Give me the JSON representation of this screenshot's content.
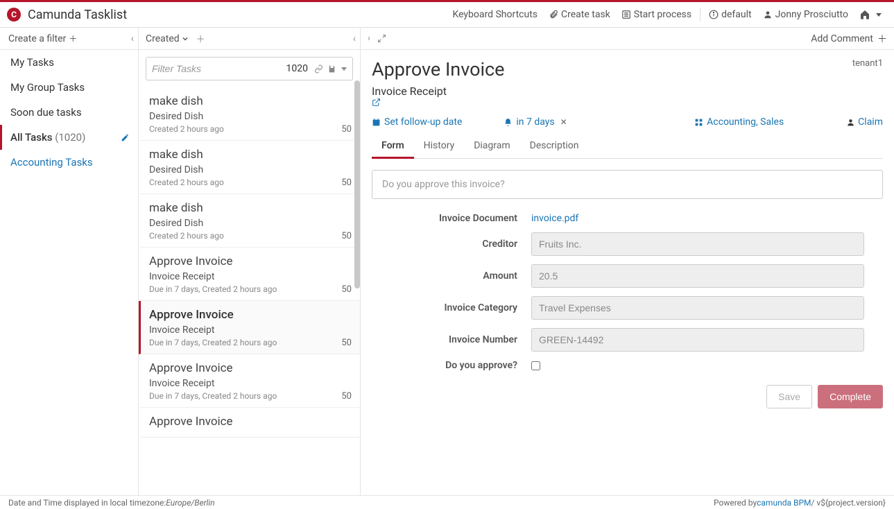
{
  "brand": {
    "logo_letter": "C",
    "title": "Camunda Tasklist",
    "keyboard_shortcuts": "Keyboard Shortcuts",
    "create_task": "Create task",
    "start_process": "Start process",
    "engine": "default",
    "user": "Jonny Prosciutto"
  },
  "filters": {
    "header": "Create a filter",
    "items": [
      {
        "label": "My Tasks",
        "count": "",
        "active": false,
        "link": false
      },
      {
        "label": "My Group Tasks",
        "count": "",
        "active": false,
        "link": false
      },
      {
        "label": "Soon due tasks",
        "count": "",
        "active": false,
        "link": false
      },
      {
        "label": "All Tasks",
        "count": "(1020)",
        "active": true,
        "link": false
      },
      {
        "label": "Accounting Tasks",
        "count": "",
        "active": false,
        "link": true
      }
    ]
  },
  "tasks": {
    "sort_label": "Created",
    "filter_placeholder": "Filter Tasks",
    "filter_count": "1020",
    "items": [
      {
        "title": "make dish",
        "sub": "Desired Dish",
        "meta": "Created 2 hours ago",
        "prio": "50",
        "selected": false
      },
      {
        "title": "make dish",
        "sub": "Desired Dish",
        "meta": "Created 2 hours ago",
        "prio": "50",
        "selected": false
      },
      {
        "title": "make dish",
        "sub": "Desired Dish",
        "meta": "Created 2 hours ago",
        "prio": "50",
        "selected": false
      },
      {
        "title": "Approve Invoice",
        "sub": "Invoice Receipt",
        "meta": "Due in 7 days, Created 2 hours ago",
        "prio": "50",
        "selected": false
      },
      {
        "title": "Approve Invoice",
        "sub": "Invoice Receipt",
        "meta": "Due in 7 days, Created 2 hours ago",
        "prio": "50",
        "selected": true
      },
      {
        "title": "Approve Invoice",
        "sub": "Invoice Receipt",
        "meta": "Due in 7 days, Created 2 hours ago",
        "prio": "50",
        "selected": false
      },
      {
        "title": "Approve Invoice",
        "sub": "",
        "meta": "",
        "prio": "",
        "selected": false
      }
    ]
  },
  "detail": {
    "add_comment": "Add Comment",
    "title": "Approve Invoice",
    "tenant": "tenant1",
    "process": "Invoice Receipt",
    "followup": "Set follow-up date",
    "due": "in 7 days",
    "groups": "Accounting, Sales",
    "claim": "Claim",
    "tabs": {
      "form": "Form",
      "history": "History",
      "diagram": "Diagram",
      "description": "Description"
    },
    "question": "Do you approve this invoice?",
    "form": {
      "invoice_document_label": "Invoice Document",
      "invoice_document_value": "invoice.pdf",
      "creditor_label": "Creditor",
      "creditor_value": "Fruits Inc.",
      "amount_label": "Amount",
      "amount_value": "20.5",
      "category_label": "Invoice Category",
      "category_value": "Travel Expenses",
      "number_label": "Invoice Number",
      "number_value": "GREEN-14492",
      "approve_label": "Do you approve?"
    },
    "actions": {
      "save": "Save",
      "complete": "Complete"
    }
  },
  "footer": {
    "tz_label": "Date and Time displayed in local timezone: ",
    "tz_value": "Europe/Berlin",
    "powered": "Powered by ",
    "product": "camunda BPM",
    "version": " / v${project.version}"
  }
}
